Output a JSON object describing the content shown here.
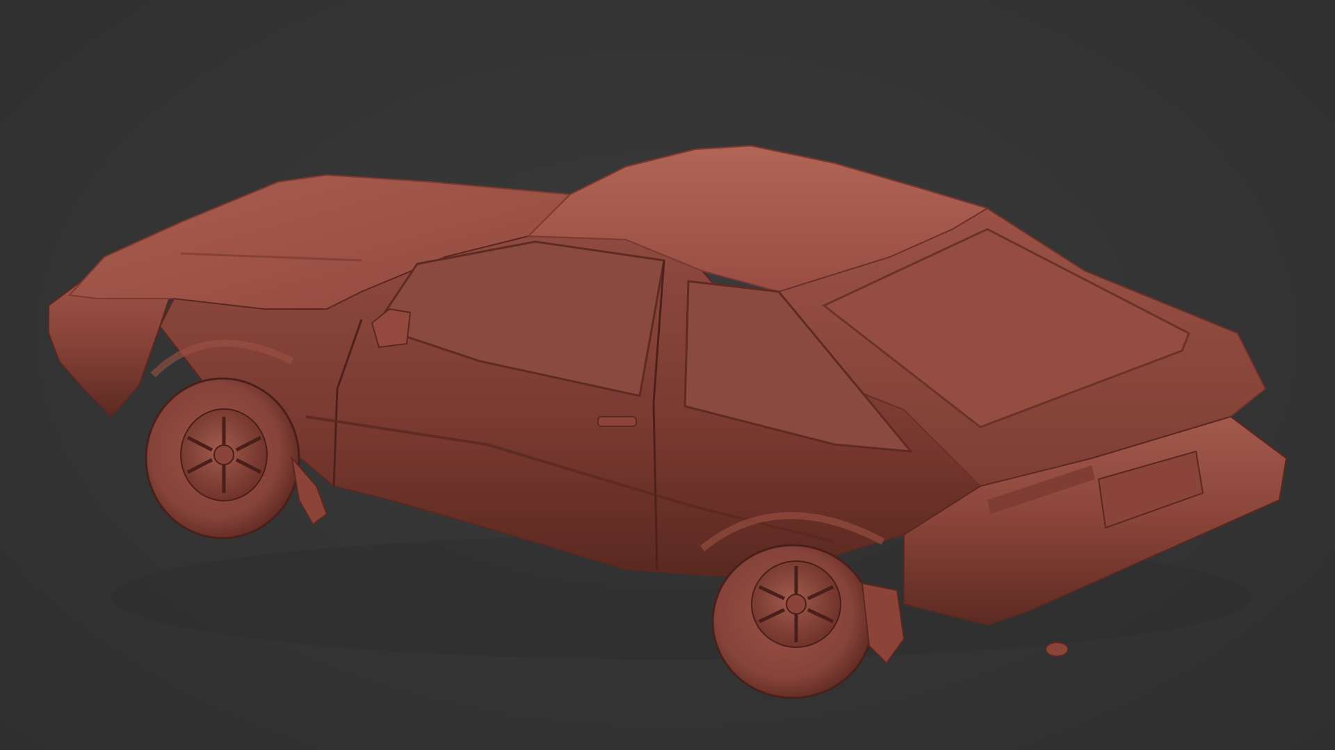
{
  "viewport": {
    "background": "#333333",
    "model_color": "#a2554a",
    "shadow_color": "#5e2a22",
    "highlight_color": "#b66a5d"
  },
  "model": {
    "subject": "hatchback-car-clay-render"
  }
}
